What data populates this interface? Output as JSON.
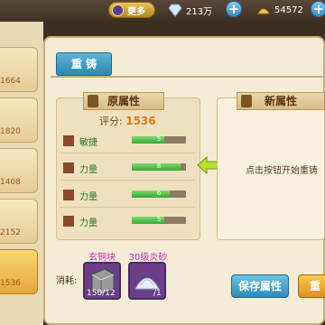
{
  "topbar": {
    "more_label": "更多",
    "diamond_value": "213万",
    "gold_value": "54572"
  },
  "left_list": {
    "items": [
      {
        "num": "1664"
      },
      {
        "num": "1820"
      },
      {
        "num": "1408"
      },
      {
        "num": "2152"
      },
      {
        "num": "1536"
      }
    ]
  },
  "tab": {
    "label": "重 铸"
  },
  "original": {
    "title": "原属性",
    "score_label": "评分:",
    "score_value": "1536",
    "attrs": [
      {
        "name": "敏捷",
        "value": "5",
        "fill": 0.6
      },
      {
        "name": "力量",
        "value": "8",
        "fill": 0.9
      },
      {
        "name": "力量",
        "value": "6",
        "fill": 0.7
      },
      {
        "name": "力量",
        "value": "5",
        "fill": 0.6
      }
    ]
  },
  "new_attrs": {
    "title": "新属性",
    "hint": "点击按钮开始重铸"
  },
  "consume": {
    "label": "消耗:",
    "materials": [
      {
        "name": "玄铜块",
        "qty": "150/12"
      },
      {
        "name": "30级炎砂",
        "qty": "/1"
      }
    ]
  },
  "buttons": {
    "save_label": "保存属性",
    "reforge_label": "重"
  },
  "colors": {
    "accent_blue": "#2f8ab8",
    "accent_gold": "#e09020",
    "attr_green": "#38a838",
    "score_orange": "#e07a10"
  }
}
